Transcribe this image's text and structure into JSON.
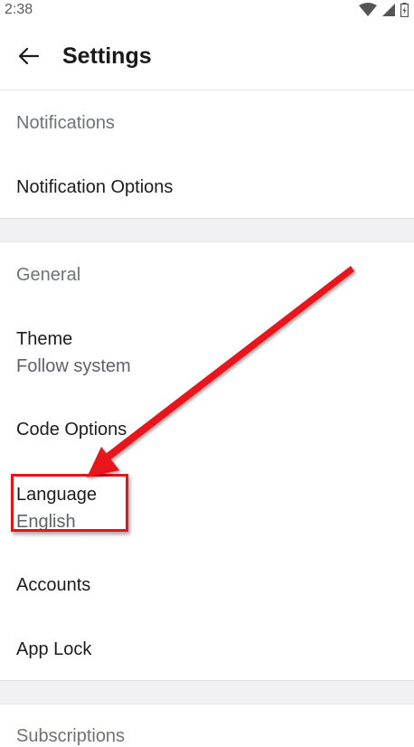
{
  "status_bar": {
    "time": "2:38",
    "icons": [
      "wifi-icon",
      "signal-icon",
      "battery-icon"
    ]
  },
  "app_bar": {
    "back_icon": "arrow-left-icon",
    "title": "Settings"
  },
  "sections": [
    {
      "title": "Notifications",
      "items": [
        {
          "label": "Notification Options"
        }
      ]
    },
    {
      "title": "General",
      "items": [
        {
          "label": "Theme",
          "value": "Follow system"
        },
        {
          "label": "Code Options"
        },
        {
          "label": "Language",
          "value": "English"
        },
        {
          "label": "Accounts"
        },
        {
          "label": "App Lock"
        }
      ]
    },
    {
      "title": "Subscriptions",
      "items": []
    }
  ],
  "colors": {
    "annotation": "#e8141a",
    "section_title": "#6f717d",
    "divider_band": "#f1f1f4"
  }
}
